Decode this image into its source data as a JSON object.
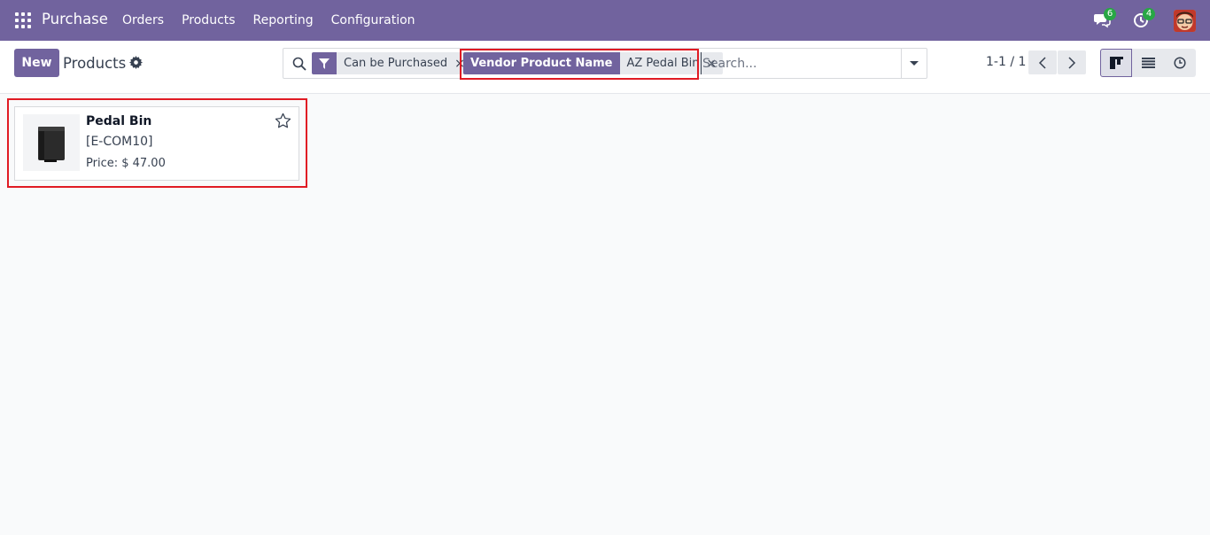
{
  "navbar": {
    "app_title": "Purchase",
    "menu": [
      "Orders",
      "Products",
      "Reporting",
      "Configuration"
    ],
    "messages_count": "6",
    "activities_count": "4",
    "colors": {
      "brand": "#71639e",
      "badge": "#28a745"
    }
  },
  "control_panel": {
    "new_label": "New",
    "title": "Products",
    "search": {
      "filter_facet": "Can be Purchased",
      "vendor_facet_label": "Vendor Product Name",
      "vendor_facet_value": "AZ Pedal Bin",
      "close_glyph": "×",
      "placeholder": "Search..."
    },
    "pager": "1-1 / 1"
  },
  "kanban": {
    "cards": [
      {
        "name": "Pedal Bin",
        "code": "[E-COM10]",
        "price": "Price: $ 47.00"
      }
    ]
  },
  "icons": [
    "apps-icon",
    "chat-icon",
    "clock-icon",
    "gear-icon",
    "search-icon",
    "filter-icon",
    "chevron-down-icon",
    "chevron-left-icon",
    "chevron-right-icon",
    "kanban-icon",
    "list-icon",
    "activity-icon",
    "star-icon"
  ],
  "highlight_color": "#e01b24"
}
